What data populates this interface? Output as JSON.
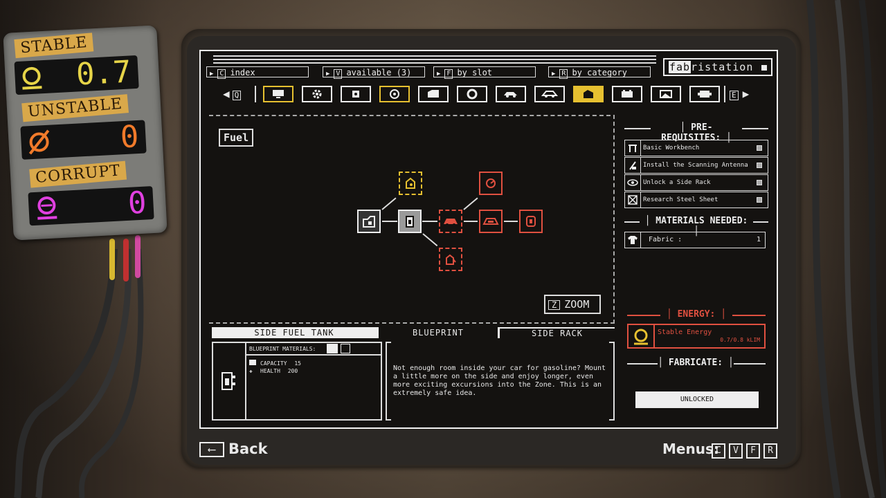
{
  "gauge": {
    "stable": {
      "label": "STABLE",
      "value": "0.7",
      "color": "#e6d448"
    },
    "unstable": {
      "label": "UNSTABLE",
      "value": "0",
      "color": "#f07a2a"
    },
    "corrupt": {
      "label": "CORRUPT",
      "value": "0",
      "color": "#e040e0"
    }
  },
  "tabs": [
    {
      "key": "C",
      "label": "index"
    },
    {
      "key": "V",
      "label": "available (3)"
    },
    {
      "key": "F",
      "label": "by slot"
    },
    {
      "key": "R",
      "label": "by category"
    }
  ],
  "brand": {
    "highlight": "fab",
    "rest": "ristation"
  },
  "category_nav": {
    "prev_key": "Q",
    "next_key": "E"
  },
  "categories": [
    {
      "icon": "monitor-icon"
    },
    {
      "icon": "gear-icon"
    },
    {
      "icon": "antenna-icon"
    },
    {
      "icon": "tire-icon"
    },
    {
      "icon": "door-icon"
    },
    {
      "icon": "wheel-icon"
    },
    {
      "icon": "car-side-icon"
    },
    {
      "icon": "car-roof-icon"
    },
    {
      "icon": "fuel-can-icon"
    },
    {
      "icon": "battery-icon"
    },
    {
      "icon": "image-icon"
    },
    {
      "icon": "engine-icon"
    }
  ],
  "tree": {
    "title": "Fuel",
    "zoom_key": "Z",
    "zoom_label": "ZOOM"
  },
  "bottom_tabs": {
    "left": "SIDE FUEL TANK",
    "center": "BLUEPRINT",
    "right": "SIDE RACK"
  },
  "blueprint": {
    "materials_label": "BLUEPRINT MATERIALS:",
    "stats": [
      {
        "icon": "fuel-can-icon",
        "label": "CAPACITY",
        "value": "15"
      },
      {
        "icon": "plus-icon",
        "label": "HEALTH",
        "value": "200"
      }
    ],
    "description": "Not enough room inside your car for gasoline? Mount a little more on the side and enjoy longer, even more exciting excursions into the Zone. This is an extremely safe idea."
  },
  "prereqs": {
    "header": "PRE-REQUISITES:",
    "items": [
      {
        "icon": "workbench-icon",
        "label": "Basic Workbench"
      },
      {
        "icon": "antenna-icon",
        "label": "Install the Scanning Antenna"
      },
      {
        "icon": "eye-icon",
        "label": "Unlock a Side Rack"
      },
      {
        "icon": "crate-icon",
        "label": "Research Steel Sheet"
      }
    ]
  },
  "materials": {
    "header": "MATERIALS NEEDED:",
    "items": [
      {
        "icon": "shirt-icon",
        "label": "Fabric :",
        "count": "1"
      }
    ]
  },
  "energy": {
    "header": "ENERGY:",
    "label": "Stable Energy",
    "value": "0.7/0.8 kLIM",
    "color": "#e05040"
  },
  "fabricate": {
    "header": "FABRICATE:",
    "button": "UNLOCKED"
  },
  "footer": {
    "back": "Back",
    "menus_label": "Menus:",
    "menu_keys": [
      "C",
      "V",
      "F",
      "R"
    ]
  }
}
